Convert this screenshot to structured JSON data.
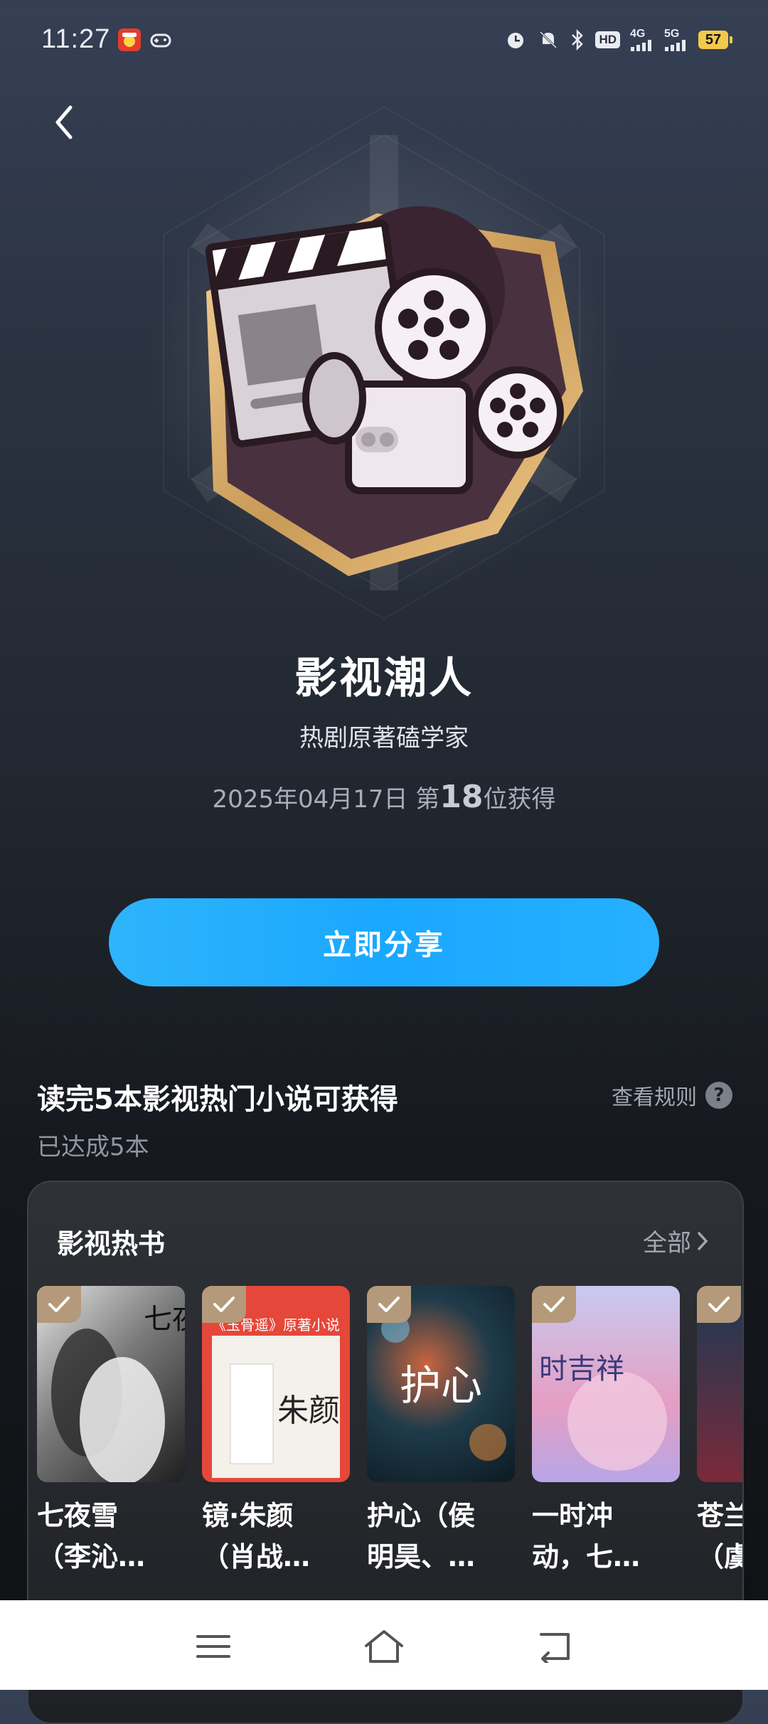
{
  "status_bar": {
    "time": "11:27",
    "hd_label": "HD",
    "net1": "4G",
    "net2": "5G",
    "battery": "57"
  },
  "badge": {
    "title": "影视潮人",
    "subtitle": "热剧原著磕学家",
    "date_prefix": "2025年04月17日 第",
    "rank": "18",
    "date_suffix": "位获得"
  },
  "share_button": "立即分享",
  "requirement": {
    "title": "读完5本影视热门小说可获得",
    "progress": "已达成5本",
    "rules_link": "查看规则",
    "help": "?"
  },
  "hot_books": {
    "title": "影视热书",
    "all_link": "全部",
    "books": [
      {
        "line1": "七夜雪",
        "line2": "（李沁…",
        "cover_text": "七夜雪",
        "colors": [
          "#d8d8d8",
          "#2a2a2a"
        ]
      },
      {
        "line1": "镜·朱颜",
        "line2": "（肖战…",
        "cover_text": "朱颜",
        "cover_band": "《玉骨遥》原著小说",
        "colors": [
          "#e5473a",
          "#f4f0ea"
        ]
      },
      {
        "line1": "护心（侯",
        "line2": "明昊、…",
        "cover_text": "护心",
        "colors": [
          "#1f3b4a",
          "#c9653f"
        ]
      },
      {
        "line1": "一时冲",
        "line2": "动，七…",
        "cover_text": "时吉祥",
        "colors": [
          "#c8c9ef",
          "#e59ec3"
        ]
      },
      {
        "line1": "苍兰",
        "line2": "（虞…",
        "cover_text": "",
        "colors": [
          "#1a3a55",
          "#7a2a3a"
        ]
      }
    ]
  }
}
